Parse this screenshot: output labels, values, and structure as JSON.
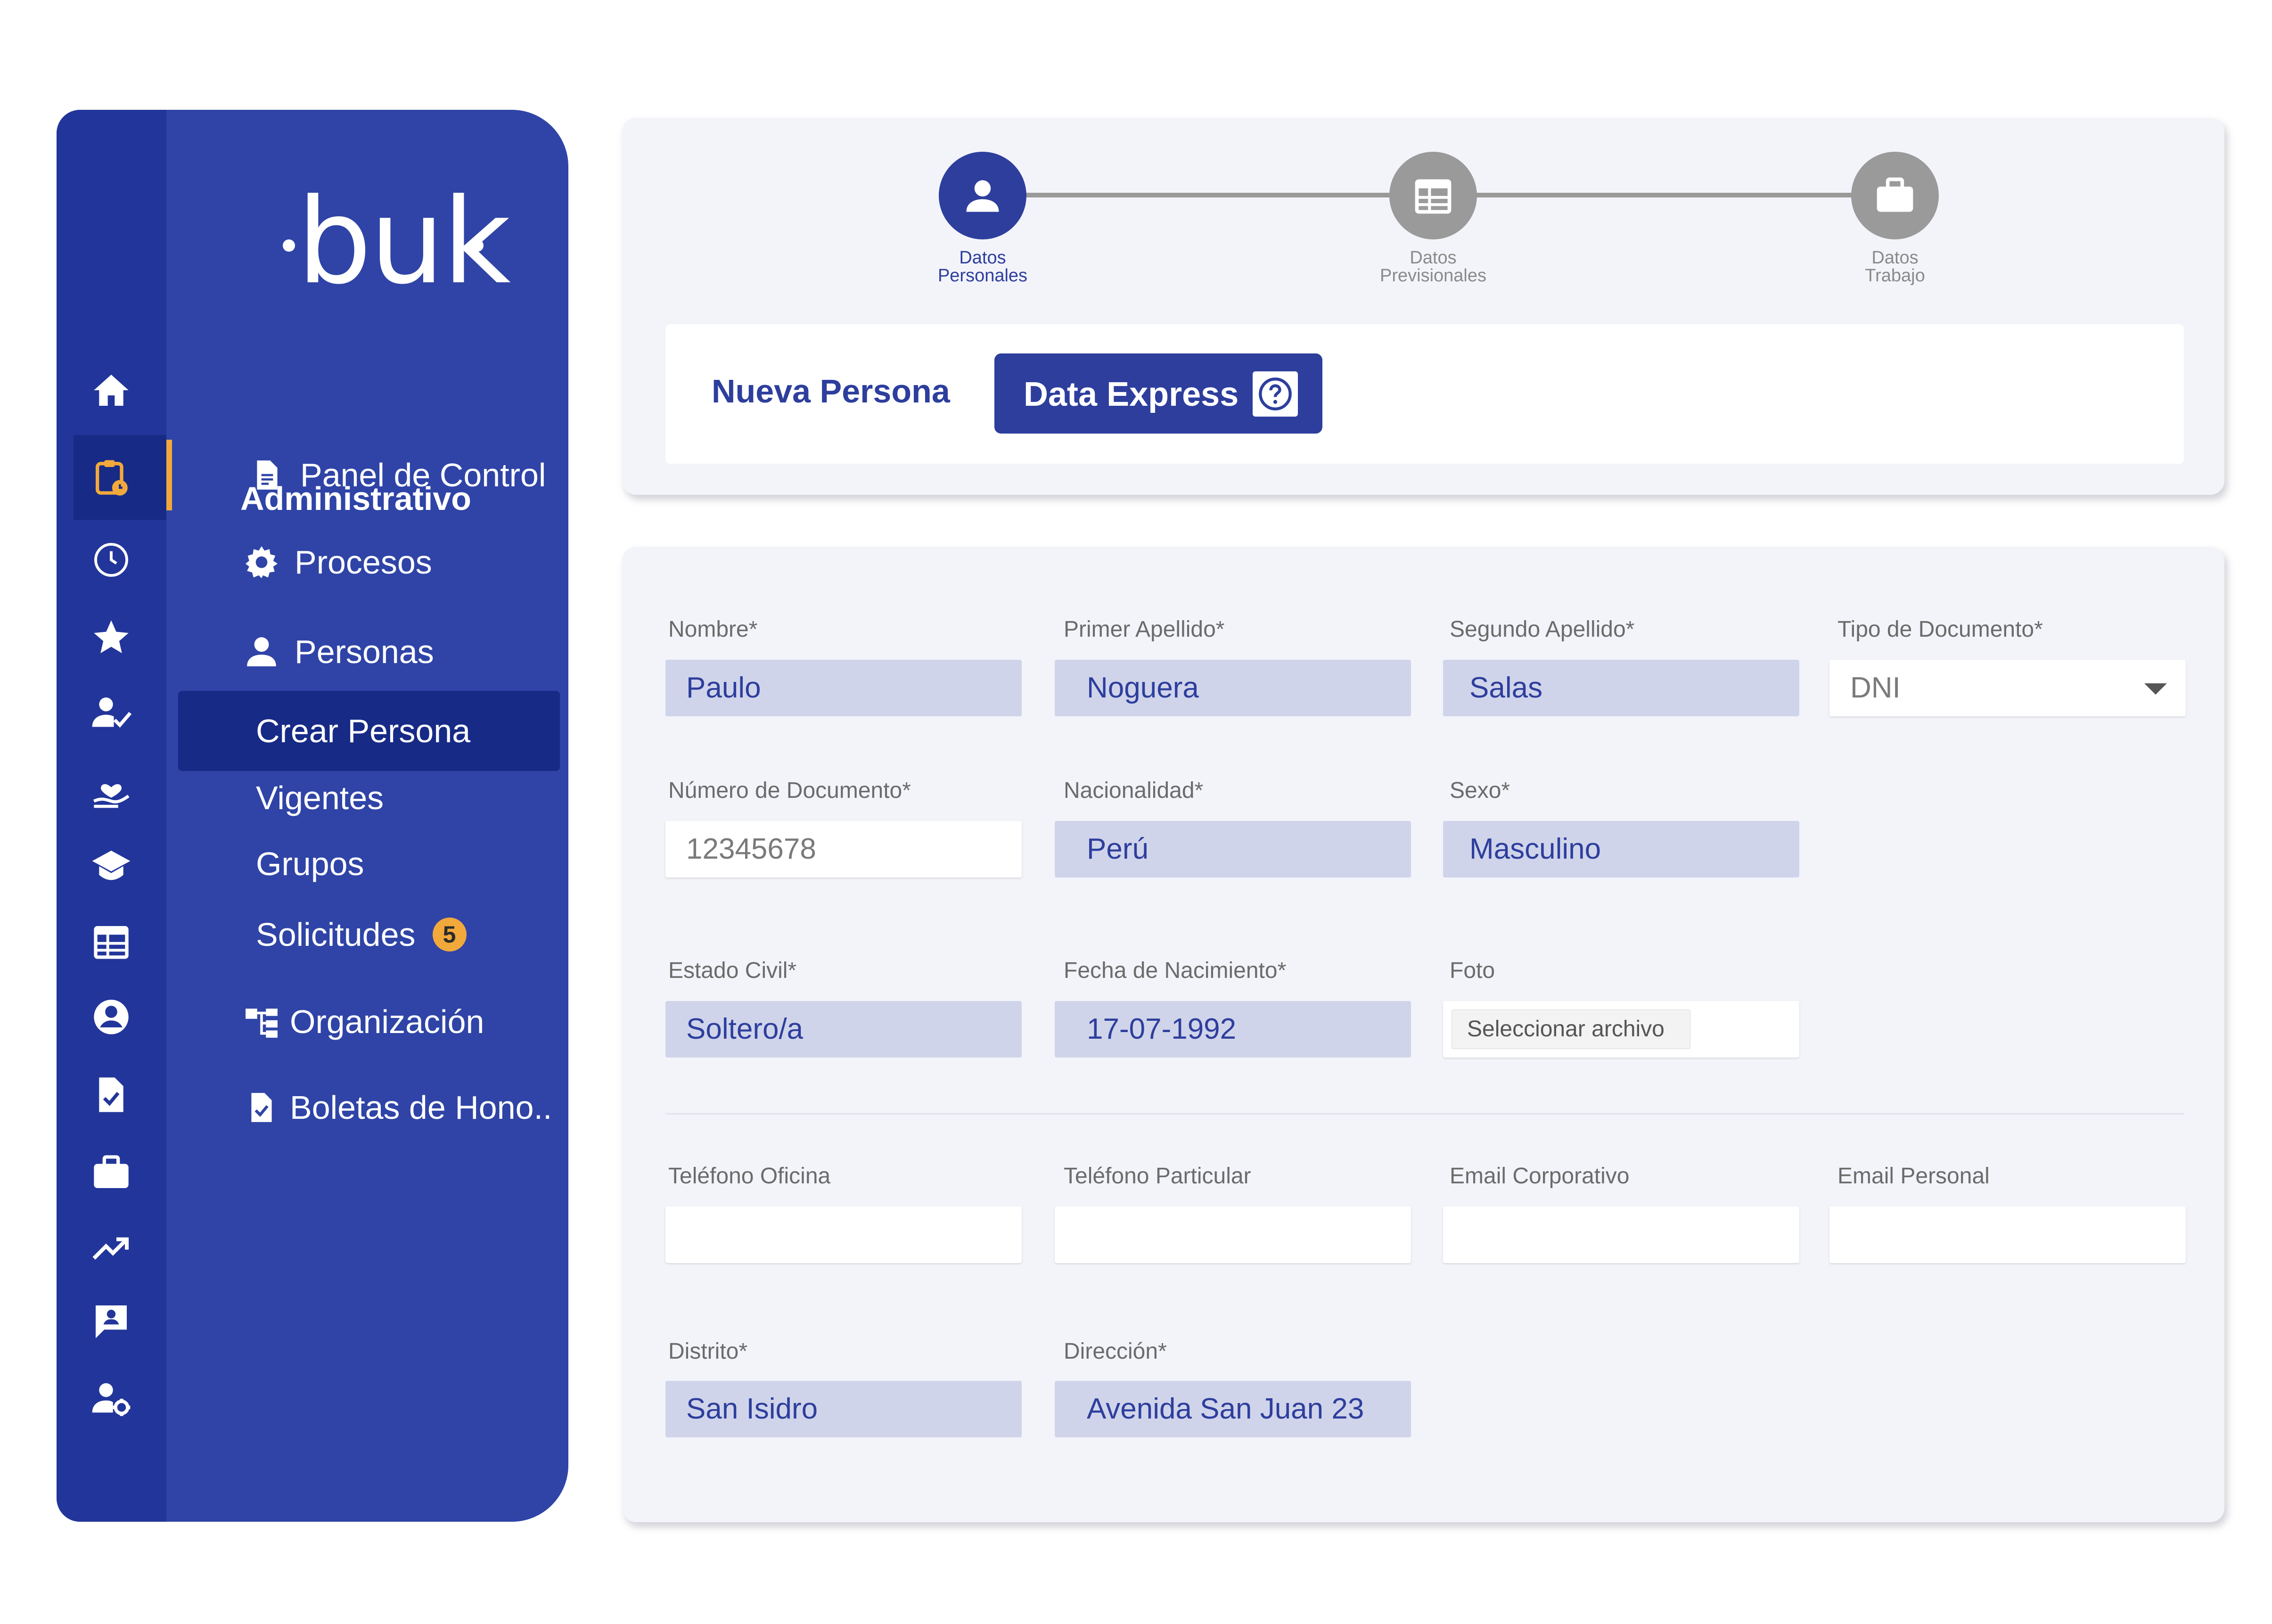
{
  "colors": {
    "sidebar": "#2f44a6",
    "rail": "#22359a",
    "rail_active": "#172a86",
    "accent": "#f2a93b",
    "primary": "#2d3e9d",
    "filled_field": "#d0d4ea"
  },
  "sidebar": {
    "logo": "buk",
    "section_title": "Administrativo",
    "rail_icons": [
      "home-icon",
      "clipboard-clock-icon",
      "clock-icon",
      "star-icon",
      "user-check-icon",
      "hand-heart-icon",
      "graduation-cap-icon",
      "calendar-table-icon",
      "user-circle-icon",
      "document-check-icon",
      "briefcase-icon",
      "trending-up-icon",
      "chat-user-icon",
      "user-settings-icon"
    ],
    "items": [
      {
        "label": "Panel de Control",
        "icon": "document-icon"
      },
      {
        "label": "Procesos",
        "icon": "gear-icon"
      },
      {
        "label": "Personas",
        "icon": "person-icon"
      },
      {
        "label": "Organización",
        "icon": "org-chart-icon"
      },
      {
        "label": "Boletas de Hono..",
        "icon": "document-check-icon"
      }
    ],
    "sub_items": [
      {
        "label": "Crear Persona"
      },
      {
        "label": "Vigentes"
      },
      {
        "label": "Grupos"
      },
      {
        "label": "Solicitudes",
        "badge": "5"
      }
    ]
  },
  "stepper": {
    "steps": [
      {
        "line1": "Datos",
        "line2": "Personales",
        "icon": "person-icon"
      },
      {
        "line1": "Datos",
        "line2": "Previsionales",
        "icon": "calendar-table-icon"
      },
      {
        "line1": "Datos",
        "line2": "Trabajo",
        "icon": "briefcase-icon"
      }
    ]
  },
  "header": {
    "title": "Nueva Persona",
    "data_express_label": "Data Express"
  },
  "form": {
    "nombre": {
      "label": "Nombre*",
      "value": "Paulo"
    },
    "primer_apellido": {
      "label": "Primer Apellido*",
      "value": "Noguera"
    },
    "segundo_apellido": {
      "label": "Segundo Apellido*",
      "value": "Salas"
    },
    "tipo_documento": {
      "label": "Tipo de Documento*",
      "value": "DNI"
    },
    "numero_documento": {
      "label": "Número de Documento*",
      "value": "12345678"
    },
    "nacionalidad": {
      "label": "Nacionalidad*",
      "value": "Perú"
    },
    "sexo": {
      "label": "Sexo*",
      "value": "Masculino"
    },
    "estado_civil": {
      "label": "Estado Civil*",
      "value": "Soltero/a"
    },
    "fecha_nacimiento": {
      "label": "Fecha de Nacimiento*",
      "value": "17-07-1992"
    },
    "foto": {
      "label": "Foto",
      "button": "Seleccionar archivo"
    },
    "telefono_oficina": {
      "label": "Teléfono Oficina",
      "value": ""
    },
    "telefono_particular": {
      "label": "Teléfono Particular",
      "value": ""
    },
    "email_corporativo": {
      "label": "Email Corporativo",
      "value": ""
    },
    "email_personal": {
      "label": "Email Personal",
      "value": ""
    },
    "distrito": {
      "label": "Distrito*",
      "value": "San Isidro"
    },
    "direccion": {
      "label": "Dirección*",
      "value": "Avenida San Juan 23"
    }
  }
}
